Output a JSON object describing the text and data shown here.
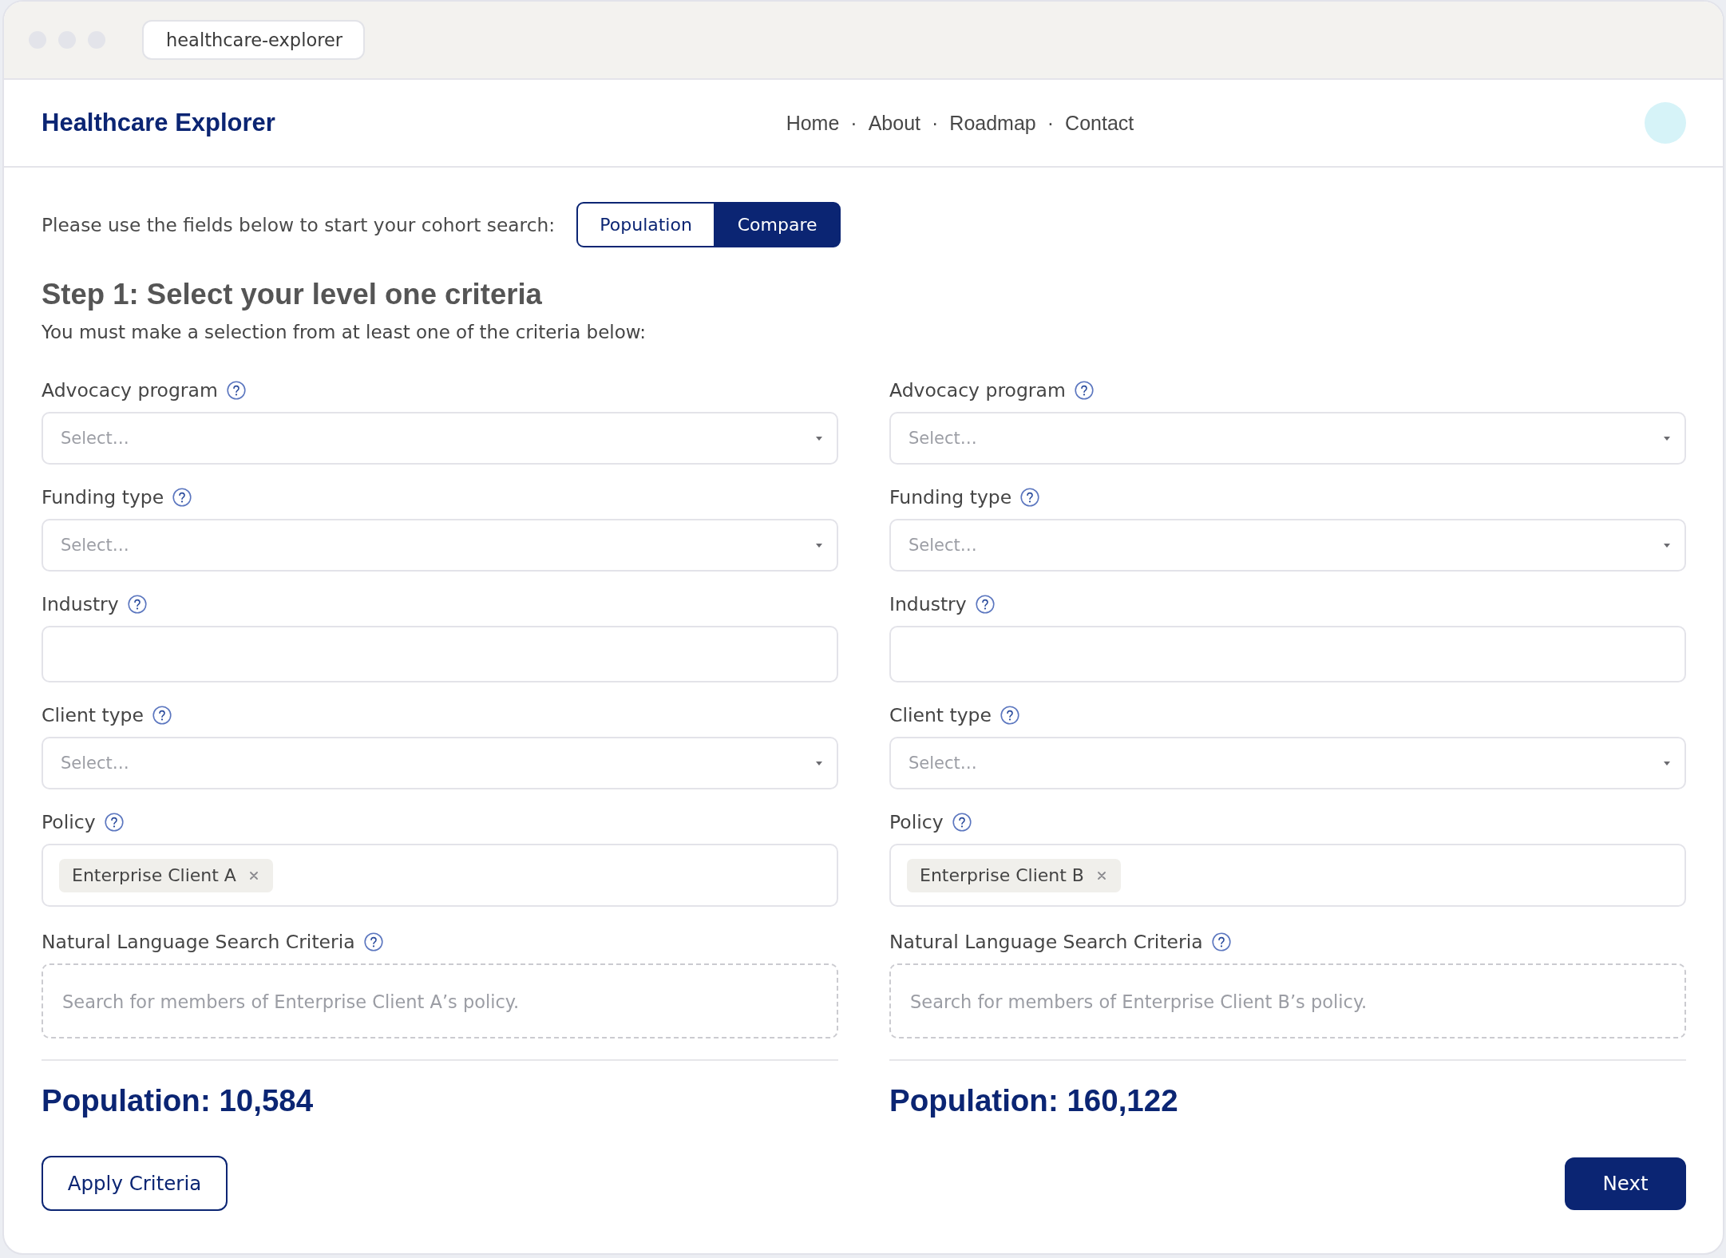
{
  "browser": {
    "tab": "healthcare-explorer"
  },
  "header": {
    "brand": "Healthcare Explorer",
    "nav": {
      "links": [
        "Home",
        "About",
        "Roadmap",
        "Contact"
      ],
      "separators": [
        "·",
        "·",
        "·"
      ]
    }
  },
  "search_mode": {
    "prompt": "Please use the fields below to start your cohort search:",
    "options": [
      {
        "label": "Population",
        "selected": false
      },
      {
        "label": "Compare",
        "selected": true
      }
    ]
  },
  "step": {
    "title": "Step 1: Select your level one criteria",
    "subtitle": "You must make a selection from at least one of the criteria below:"
  },
  "cohorts": [
    {
      "fields": [
        {
          "kind": "select",
          "label": "Advocacy program",
          "placeholder": "Select…"
        },
        {
          "kind": "select",
          "label": "Funding type",
          "placeholder": "Select…"
        },
        {
          "kind": "text",
          "label": "Industry"
        },
        {
          "kind": "select",
          "label": "Client type",
          "placeholder": "Select…"
        },
        {
          "kind": "tags",
          "label": "Policy",
          "tags": [
            "Enterprise Client A"
          ]
        },
        {
          "kind": "search",
          "label": "Natural Language Search Criteria",
          "placeholder": "Search for members of Enterprise Client A’s policy."
        }
      ],
      "population": "Population: 10,584"
    },
    {
      "fields": [
        {
          "kind": "select",
          "label": "Advocacy program",
          "placeholder": "Select…"
        },
        {
          "kind": "select",
          "label": "Funding type",
          "placeholder": "Select…"
        },
        {
          "kind": "text",
          "label": "Industry"
        },
        {
          "kind": "select",
          "label": "Client type",
          "placeholder": "Select…"
        },
        {
          "kind": "tags",
          "label": "Policy",
          "tags": [
            "Enterprise Client B"
          ]
        },
        {
          "kind": "search",
          "label": "Natural Language Search Criteria",
          "placeholder": "Search for members of Enterprise Client B’s policy."
        }
      ],
      "population": "Population: 160,122"
    }
  ],
  "actions": [
    {
      "kind": "outline",
      "label": "Apply Criteria"
    },
    {
      "kind": "primary",
      "label": "Next"
    }
  ]
}
